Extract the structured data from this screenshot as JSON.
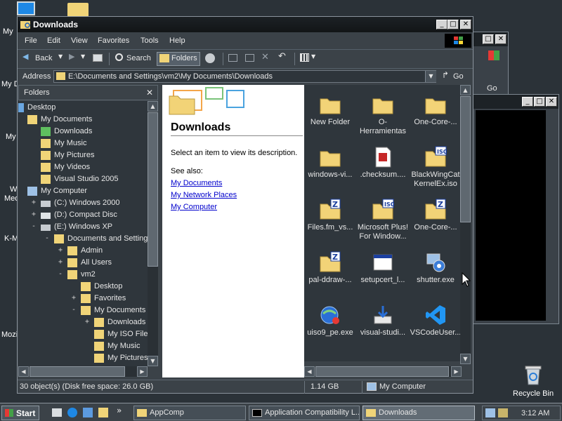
{
  "desktop": {
    "partial_labels": [
      "My",
      "My D",
      "My",
      "W",
      "Med",
      "K-M",
      "Mozi"
    ],
    "recycle_bin": "Recycle Bin"
  },
  "window": {
    "title": "Downloads",
    "menu": [
      "File",
      "Edit",
      "View",
      "Favorites",
      "Tools",
      "Help"
    ],
    "toolbar": {
      "back": "Back",
      "search": "Search",
      "folders": "Folders"
    },
    "address_label": "Address",
    "address_value": "E:\\Documents and Settings\\vm2\\My Documents\\Downloads",
    "go_label": "Go"
  },
  "folders_pane": {
    "header": "Folders",
    "tree": [
      {
        "label": "Desktop",
        "depth": 0,
        "icon": "desktop-icon",
        "toggle": ""
      },
      {
        "label": "My Documents",
        "depth": 1,
        "icon": "folder-icon",
        "toggle": ""
      },
      {
        "label": "Downloads",
        "depth": 2,
        "icon": "downloads-folder-icon",
        "toggle": ""
      },
      {
        "label": "My Music",
        "depth": 2,
        "icon": "music-folder-icon",
        "toggle": ""
      },
      {
        "label": "My Pictures",
        "depth": 2,
        "icon": "pictures-folder-icon",
        "toggle": ""
      },
      {
        "label": "My Videos",
        "depth": 2,
        "icon": "videos-folder-icon",
        "toggle": ""
      },
      {
        "label": "Visual Studio 2005",
        "depth": 2,
        "icon": "folder-icon",
        "toggle": ""
      },
      {
        "label": "My Computer",
        "depth": 1,
        "icon": "computer-icon",
        "toggle": ""
      },
      {
        "label": "(C:) Windows 2000",
        "depth": 2,
        "icon": "drive-icon",
        "toggle": "+"
      },
      {
        "label": "(D:) Compact Disc",
        "depth": 2,
        "icon": "cd-drive-icon",
        "toggle": "+"
      },
      {
        "label": "(E:) Windows XP",
        "depth": 2,
        "icon": "drive-icon",
        "toggle": "-"
      },
      {
        "label": "Documents and Settings",
        "depth": 3,
        "icon": "folder-icon",
        "toggle": "-"
      },
      {
        "label": "Admin",
        "depth": 4,
        "icon": "folder-icon",
        "toggle": "+"
      },
      {
        "label": "All Users",
        "depth": 4,
        "icon": "folder-icon",
        "toggle": "+"
      },
      {
        "label": "vm2",
        "depth": 4,
        "icon": "folder-icon",
        "toggle": "-"
      },
      {
        "label": "Desktop",
        "depth": 5,
        "icon": "folder-icon",
        "toggle": ""
      },
      {
        "label": "Favorites",
        "depth": 5,
        "icon": "favorites-folder-icon",
        "toggle": "+"
      },
      {
        "label": "My Documents",
        "depth": 5,
        "icon": "folder-icon",
        "toggle": "-"
      },
      {
        "label": "Downloads",
        "depth": 6,
        "icon": "folder-icon",
        "toggle": "+"
      },
      {
        "label": "My ISO Files",
        "depth": 6,
        "icon": "folder-icon",
        "toggle": ""
      },
      {
        "label": "My Music",
        "depth": 6,
        "icon": "music-folder-icon",
        "toggle": ""
      },
      {
        "label": "My Pictures",
        "depth": 6,
        "icon": "pictures-folder-icon",
        "toggle": ""
      }
    ]
  },
  "web_view": {
    "title": "Downloads",
    "description": "Select an item to view its description.",
    "see_also": "See also:",
    "links": [
      "My Documents",
      "My Network Places",
      "My Computer"
    ]
  },
  "files": [
    {
      "name": "New Folder",
      "icon": "folder-icon"
    },
    {
      "name": "O-Herramientas",
      "icon": "folder-icon"
    },
    {
      "name": "One-Core-...",
      "icon": "folder-icon"
    },
    {
      "name": "windows-vi...",
      "icon": "folder-icon"
    },
    {
      "name": ".checksum....",
      "icon": "document-icon"
    },
    {
      "name": "BlackWingCat KernelEx.iso",
      "icon": "iso-folder-icon"
    },
    {
      "name": "Files.fm_vs...",
      "icon": "zip-folder-icon"
    },
    {
      "name": "Microsoft Plus! For Window...",
      "icon": "iso-folder-icon"
    },
    {
      "name": "One-Core-...",
      "icon": "zip-folder-icon"
    },
    {
      "name": "pal-ddraw-...",
      "icon": "zip-folder-icon"
    },
    {
      "name": "setupcert_l...",
      "icon": "application-window-icon"
    },
    {
      "name": "shutter.exe",
      "icon": "shutter-app-icon"
    },
    {
      "name": "uiso9_pe.exe",
      "icon": "globe-app-icon"
    },
    {
      "name": "visual-studi...",
      "icon": "installer-icon"
    },
    {
      "name": "VSCodeUser...",
      "icon": "vscode-icon"
    }
  ],
  "status": {
    "objects": "30 object(s) (Disk free space: 26.0 GB)",
    "size": "1.14 GB",
    "zone": "My Computer"
  },
  "taskbar": {
    "start": "Start",
    "buttons": [
      {
        "label": "AppComp",
        "active": false
      },
      {
        "label": "Application Compatibility L...",
        "active": false
      },
      {
        "label": "Downloads",
        "active": true
      }
    ],
    "clock": "3:12 AM"
  }
}
